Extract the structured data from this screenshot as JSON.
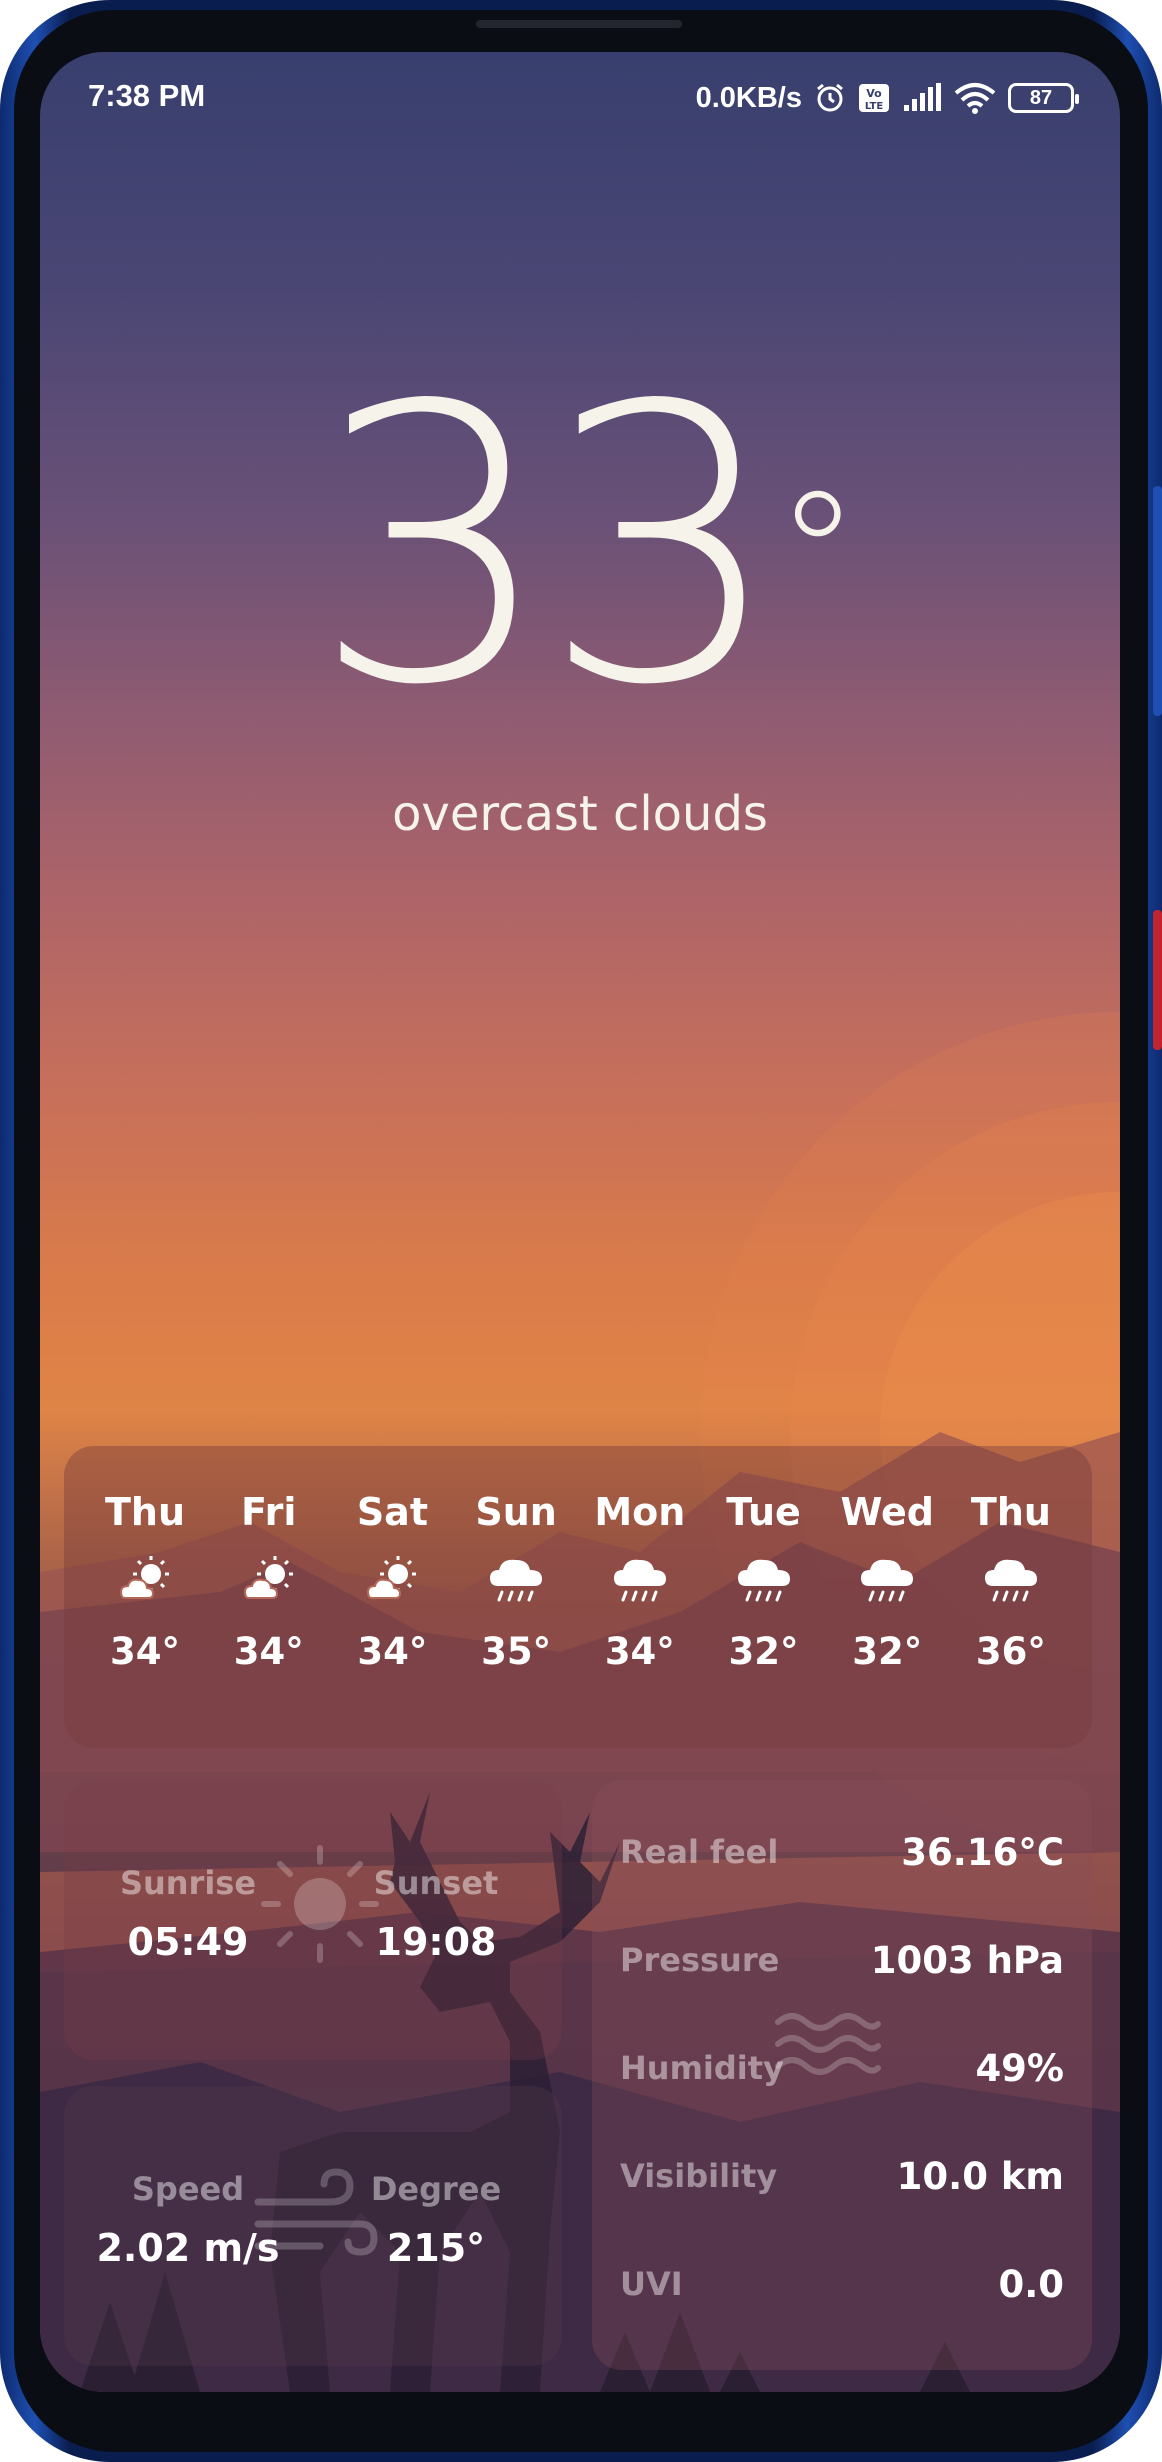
{
  "status_bar": {
    "time": "7:38 PM",
    "network_speed": "0.0KB/s",
    "battery": "87",
    "icons": [
      "alarm-icon",
      "volte-icon",
      "signal-icon",
      "wifi-icon",
      "battery-icon"
    ]
  },
  "current": {
    "temperature": "33",
    "degree_symbol": "°",
    "description": "overcast clouds"
  },
  "forecast": [
    {
      "day": "Thu",
      "icon": "partly-sunny-icon",
      "temp": "34°"
    },
    {
      "day": "Fri",
      "icon": "partly-sunny-icon",
      "temp": "34°"
    },
    {
      "day": "Sat",
      "icon": "partly-sunny-icon",
      "temp": "34°"
    },
    {
      "day": "Sun",
      "icon": "rain-cloud-icon",
      "temp": "35°"
    },
    {
      "day": "Mon",
      "icon": "rain-cloud-icon",
      "temp": "34°"
    },
    {
      "day": "Tue",
      "icon": "rain-cloud-icon",
      "temp": "32°"
    },
    {
      "day": "Wed",
      "icon": "rain-cloud-icon",
      "temp": "32°"
    },
    {
      "day": "Thu",
      "icon": "rain-cloud-icon",
      "temp": "36°"
    }
  ],
  "sun": {
    "sunrise_label": "Sunrise",
    "sunrise": "05:49",
    "sunset_label": "Sunset",
    "sunset": "19:08"
  },
  "wind": {
    "speed_label": "Speed",
    "speed": "2.02 m/s",
    "degree_label": "Degree",
    "degree": "215°"
  },
  "details": [
    {
      "label": "Real feel",
      "value": "36.16°C"
    },
    {
      "label": "Pressure",
      "value": "1003 hPa"
    },
    {
      "label": "Humidity",
      "value": "49%"
    },
    {
      "label": "Visibility",
      "value": "10.0 km"
    },
    {
      "label": "UVI",
      "value": "0.0"
    }
  ],
  "colors": {
    "sky_top": "#383f6e",
    "sky_sunset": "#df8447",
    "ground": "#3d2a45",
    "phone_frame": "#1e4fb2",
    "text": "#f6f3ea"
  }
}
